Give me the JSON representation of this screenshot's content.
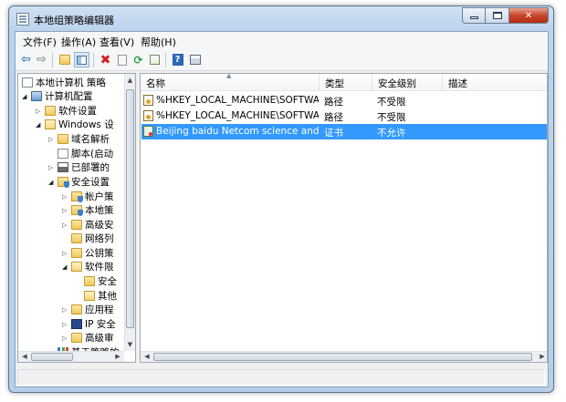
{
  "window": {
    "title": "本地组策略编辑器"
  },
  "menu": [
    "文件(F)",
    "操作(A)",
    "查看(V)",
    "帮助(H)"
  ],
  "toolbar": {
    "buttons": [
      "back-arrow-icon",
      "forward-arrow-icon",
      "up-folder-icon",
      "show-tree-icon",
      "delete-icon",
      "properties-icon",
      "refresh-icon",
      "export-list-icon",
      "help-icon",
      "console-view-icon"
    ]
  },
  "tree": {
    "items": [
      {
        "label": "本地计算机 策略",
        "icon": "document-icon"
      },
      {
        "label": "计算机配置",
        "icon": "computer-icon"
      },
      {
        "label": "软件设置",
        "icon": "folder-icon"
      },
      {
        "label": "Windows 设",
        "icon": "folder-icon"
      },
      {
        "label": "域名解析",
        "icon": "folder-icon"
      },
      {
        "label": "脚本(启动",
        "icon": "document-icon"
      },
      {
        "label": "已部署的",
        "icon": "printer-icon"
      },
      {
        "label": "安全设置",
        "icon": "shield-folder-icon"
      },
      {
        "label": "帐户策",
        "icon": "shield-folder-icon"
      },
      {
        "label": "本地策",
        "icon": "shield-folder-icon"
      },
      {
        "label": "高级安",
        "icon": "folder-icon"
      },
      {
        "label": "网络列",
        "icon": "folder-icon"
      },
      {
        "label": "公钥策",
        "icon": "folder-icon"
      },
      {
        "label": "软件限",
        "icon": "folder-icon"
      },
      {
        "label": "安全",
        "icon": "folder-icon"
      },
      {
        "label": "其他",
        "icon": "folder-icon"
      },
      {
        "label": "应用程",
        "icon": "folder-icon"
      },
      {
        "label": "IP 安全",
        "icon": "ip-security-icon"
      },
      {
        "label": "高级审",
        "icon": "folder-icon"
      },
      {
        "label": "基于策略的",
        "icon": "chart-icon"
      }
    ]
  },
  "list": {
    "columns": [
      "名称",
      "类型",
      "安全级别",
      "描述"
    ],
    "rows": [
      {
        "name": "%HKEY_LOCAL_MACHINE\\SOFTWAR...",
        "type": "路径",
        "level": "不受限",
        "desc": ""
      },
      {
        "name": "%HKEY_LOCAL_MACHINE\\SOFTWAR...",
        "type": "路径",
        "level": "不受限",
        "desc": ""
      },
      {
        "name": "Beijing baidu Netcom science and te...",
        "type": "证书",
        "level": "不允许",
        "desc": ""
      }
    ]
  },
  "colors": {
    "selection": "#3399ff",
    "title_bar": "#bcd3ec"
  }
}
